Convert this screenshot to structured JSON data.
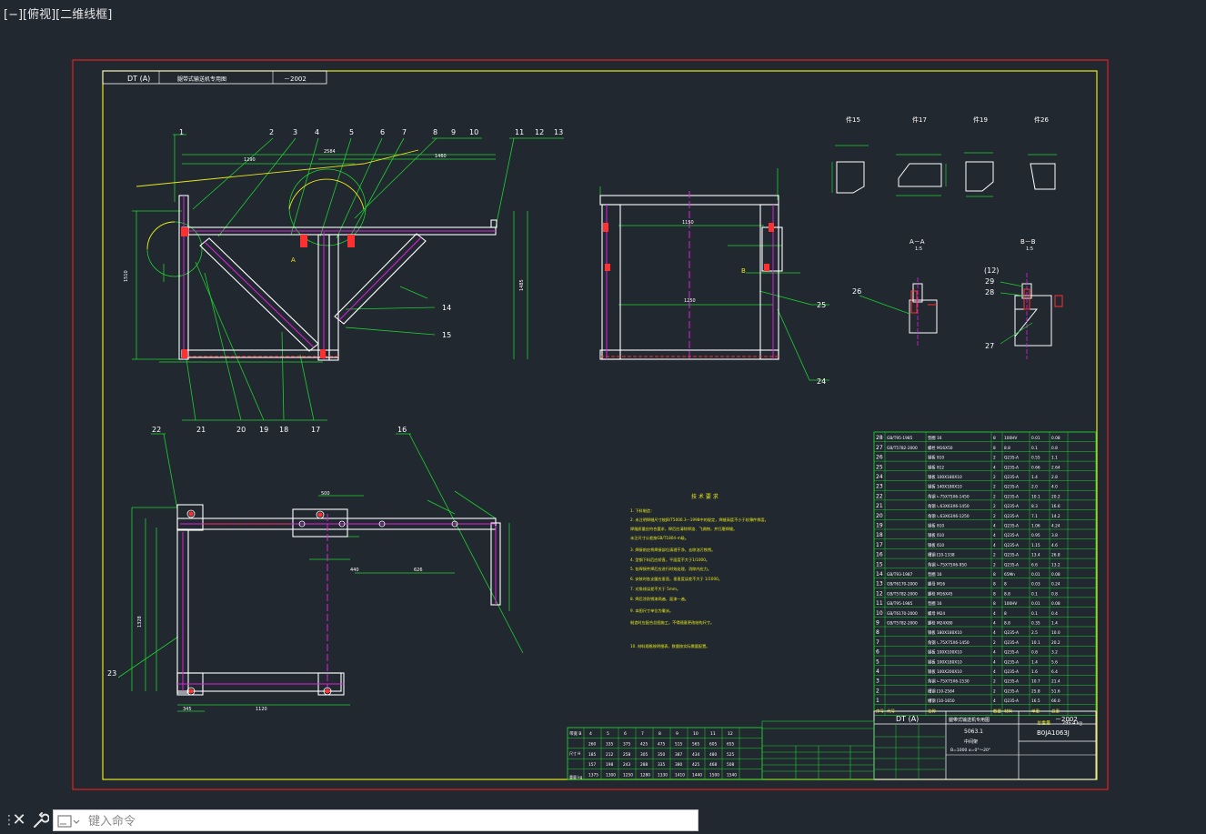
{
  "viewport": {
    "label": "[−][俯视][二维线框]"
  },
  "title_block_top": {
    "code": "DT (A)",
    "title": "腿带式输送机专用图",
    "year": "－2002"
  },
  "item_numbers_top": [
    "1",
    "2",
    "3",
    "4",
    "5",
    "6",
    "7",
    "8",
    "9",
    "10",
    "11",
    "12",
    "13"
  ],
  "item_numbers_side": [
    "14",
    "15",
    "16",
    "17",
    "18",
    "19",
    "20",
    "21",
    "22",
    "23",
    "24",
    "25",
    "26",
    "27",
    "28",
    "29",
    "(12)"
  ],
  "section_labels": {
    "a": "A－A",
    "a_scale": "1:5",
    "b": "B－B",
    "b_scale": "1:5",
    "p15": "件15",
    "p17": "件17",
    "p19": "件19",
    "p26": "件26"
  },
  "dims": {
    "d1": "1290",
    "d2": "1460",
    "d3": "2584",
    "d4": "1150",
    "d5": "1250",
    "d6": "500",
    "d7": "1120",
    "d8": "345",
    "d9": "440",
    "d10": "626",
    "d11": "1510",
    "d12": "1328",
    "d13": "1485"
  },
  "notes": {
    "heading": "技 术 要 求",
    "lines": [
      "1. 下料制造：",
      "2. 未注明焊缝尺寸按JB/T5000.3—1998中的规定，焊缝高度不小于较薄件厚度。",
      "   焊缝质量应符合要求，焊后应清除焊渣、飞溅物，并打磨焊缝。",
      "   未注尺寸公差按GB/T1804-m级。",
      "3. 焊接前应将焊接部位清理干净，去除油污铁锈。",
      "4. 型钢下料后应矫直，平面度不大于1/1000。",
      "5. 各焊接件焊后应进行时效处理，消除内应力。",
      "6. 安装时各支腿应垂直，垂直度误差不大于 1/1000。",
      "7. 对角线误差不大于 5mm。",
      "8. 焊后涂防锈漆两遍，面漆一遍。",
      "9. 本图尺寸单位为毫米。",
      "   制造时应配合总图施工，不得随意更改结构尺寸。",
      "10. 材料规格按明细表，数量按实际需要配置。"
    ]
  },
  "bom": {
    "rows": [
      [
        "28",
        "GB/T95-1985",
        "垫圈 16",
        "8",
        "100HV",
        "0.01",
        "0.08"
      ],
      [
        "27",
        "GB/T5782-2000",
        "螺栓 M16X50",
        "8",
        "8.8",
        "0.1",
        "0.8"
      ],
      [
        "26",
        "",
        "钢板 δ10",
        "2",
        "Q235-A",
        "0.55",
        "1.1"
      ],
      [
        "25",
        "",
        "钢板 δ12",
        "4",
        "Q235-A",
        "0.66",
        "2.64"
      ],
      [
        "24",
        "",
        "钢板 100X180X10",
        "2",
        "Q235-A",
        "1.4",
        "2.8"
      ],
      [
        "23",
        "",
        "钢板 140X180X10",
        "2",
        "Q235-A",
        "2.0",
        "4.0"
      ],
      [
        "22",
        "",
        "角钢 ∟75X75X6-1450",
        "2",
        "Q235-A",
        "10.1",
        "20.2"
      ],
      [
        "21",
        "",
        "角钢 ∟63X63X6-1450",
        "2",
        "Q235-A",
        "8.3",
        "16.6"
      ],
      [
        "20",
        "",
        "角钢 ∟63X63X6-1250",
        "2",
        "Q235-A",
        "7.1",
        "14.2"
      ],
      [
        "19",
        "",
        "钢板 δ10",
        "4",
        "Q235-A",
        "1.06",
        "4.24"
      ],
      [
        "18",
        "",
        "钢板 δ10",
        "4",
        "Q235-A",
        "0.95",
        "3.8"
      ],
      [
        "17",
        "",
        "钢板 δ10",
        "4",
        "Q235-A",
        "1.15",
        "4.6"
      ],
      [
        "16",
        "",
        "槽钢 [10-1338",
        "2",
        "Q235-A",
        "13.4",
        "26.8"
      ],
      [
        "15",
        "",
        "角钢 ∟75X75X6-950",
        "2",
        "Q235-A",
        "6.6",
        "13.2"
      ],
      [
        "14",
        "GB/T93-1987",
        "垫圈 16",
        "8",
        "65Mn",
        "0.01",
        "0.08"
      ],
      [
        "13",
        "GB/T6170-2000",
        "螺母 M16",
        "8",
        "8",
        "0.03",
        "0.24"
      ],
      [
        "12",
        "GB/T5782-2000",
        "螺栓 M16X45",
        "8",
        "8.8",
        "0.1",
        "0.8"
      ],
      [
        "11",
        "GB/T95-1985",
        "垫圈 16",
        "8",
        "100HV",
        "0.01",
        "0.08"
      ],
      [
        "10",
        "GB/T6170-2000",
        "螺母 M24",
        "4",
        "8",
        "0.1",
        "0.4"
      ],
      [
        "9",
        "GB/T5782-2000",
        "螺栓 M24X80",
        "4",
        "8.8",
        "0.35",
        "1.4"
      ],
      [
        "8",
        "",
        "钢板 180X180X10",
        "4",
        "Q235-A",
        "2.5",
        "10.0"
      ],
      [
        "7",
        "",
        "角钢 ∟75X75X6-1450",
        "2",
        "Q235-A",
        "10.1",
        "20.2"
      ],
      [
        "6",
        "",
        "钢板 100X100X10",
        "4",
        "Q235-A",
        "0.8",
        "3.2"
      ],
      [
        "5",
        "",
        "钢板 100X180X10",
        "4",
        "Q235-A",
        "1.4",
        "5.6"
      ],
      [
        "4",
        "",
        "钢板 100X200X10",
        "4",
        "Q235-A",
        "1.6",
        "6.4"
      ],
      [
        "3",
        "",
        "角钢 ∟75X75X6-1530",
        "2",
        "Q235-A",
        "10.7",
        "21.4"
      ],
      [
        "2",
        "",
        "槽钢 [10-2584",
        "2",
        "Q235-A",
        "25.8",
        "51.6"
      ],
      [
        "1",
        "",
        "槽钢 [10-1650",
        "4",
        "Q235-A",
        "16.5",
        "66.0"
      ]
    ],
    "header": [
      "序号",
      "代号",
      "名称",
      "数量",
      "材料",
      "单重",
      "总重"
    ],
    "total_label": "总重量",
    "total_value": "295.4 kg"
  },
  "title_block_main": {
    "code": "DT (A)",
    "title": "腿带式输送机专用图",
    "year": "－2002",
    "drawing_no": "B0JA1063J",
    "part_name": "5063.1",
    "part_desc": "中间架",
    "spec": "B=1000 α=0°～20°"
  },
  "bottom_table": {
    "header": [
      "带宽 B",
      "4",
      "5",
      "6",
      "7",
      "8",
      "9",
      "10",
      "11",
      "12"
    ],
    "row_labels": [
      "尺寸 H",
      "",
      "",
      "重量 kg"
    ],
    "rows": [
      [
        "",
        "260",
        "335",
        "375",
        "425",
        "475",
        "515",
        "565",
        "605",
        "655"
      ],
      [
        "",
        "185",
        "212",
        "258",
        "305",
        "350",
        "387",
        "434",
        "480",
        "525"
      ],
      [
        "",
        "157",
        "198",
        "243",
        "288",
        "335",
        "380",
        "425",
        "468",
        "508"
      ],
      [
        "",
        "1375",
        "1300",
        "1250",
        "1280",
        "1330",
        "1410",
        "1440",
        "1500",
        "1540"
      ]
    ]
  },
  "cmd": {
    "placeholder": "键入命令"
  },
  "colors": {
    "background": "#212830",
    "frame_red": "#e01f1f",
    "frame_yellow": "#e8e81a",
    "green": "#1fd02f",
    "white": "#ffffff",
    "magenta": "#e020e0",
    "cyan": "#20e0e0",
    "red": "#ff3030"
  }
}
